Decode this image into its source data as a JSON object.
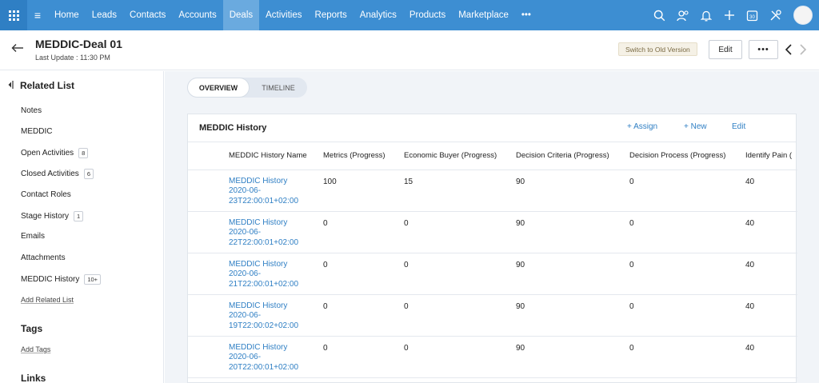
{
  "nav": {
    "items": [
      {
        "label": "Home",
        "active": false
      },
      {
        "label": "Leads",
        "active": false
      },
      {
        "label": "Contacts",
        "active": false
      },
      {
        "label": "Accounts",
        "active": false
      },
      {
        "label": "Deals",
        "active": true
      },
      {
        "label": "Activities",
        "active": false
      },
      {
        "label": "Reports",
        "active": false
      },
      {
        "label": "Analytics",
        "active": false
      },
      {
        "label": "Products",
        "active": false
      },
      {
        "label": "Marketplace",
        "active": false
      }
    ],
    "more": "•••",
    "icons": [
      "search-icon",
      "contacts-icon",
      "bell-icon",
      "plus-icon",
      "calendar-icon",
      "settings-icon"
    ],
    "calendar_day": "30"
  },
  "header": {
    "title": "MEDDIC-Deal 01",
    "last_update": "Last Update : 11:30 PM",
    "switch_label": "Switch to Old Version",
    "edit_label": "Edit",
    "more_label": "•••"
  },
  "sidebar": {
    "heading": "Related List",
    "items": [
      {
        "label": "Notes",
        "badge": ""
      },
      {
        "label": "MEDDIC",
        "badge": ""
      },
      {
        "label": "Open Activities",
        "badge": "8"
      },
      {
        "label": "Closed Activities",
        "badge": "6"
      },
      {
        "label": "Contact Roles",
        "badge": ""
      },
      {
        "label": "Stage History",
        "badge": "1"
      },
      {
        "label": "Emails",
        "badge": ""
      },
      {
        "label": "Attachments",
        "badge": ""
      },
      {
        "label": "MEDDIC History",
        "badge": "10+"
      }
    ],
    "add_related": "Add Related List",
    "tags_heading": "Tags",
    "add_tags": "Add Tags",
    "links_heading": "Links"
  },
  "tabs": {
    "overview": "OVERVIEW",
    "timeline": "TIMELINE"
  },
  "card": {
    "title": "MEDDIC History",
    "assign": "+ Assign",
    "new": "+ New",
    "edit": "Edit",
    "columns": [
      "MEDDIC History Name",
      "Metrics (Progress)",
      "Economic Buyer (Progress)",
      "Decision Criteria (Progress)",
      "Decision Process (Progress)",
      "Identify Pain ("
    ],
    "rows": [
      {
        "name_1": "MEDDIC History",
        "name_2": "2020-06-",
        "name_3": "23T22:00:01+02:00",
        "metrics": "100",
        "buyer": "15",
        "criteria": "90",
        "process": "0",
        "pain": "40"
      },
      {
        "name_1": "MEDDIC History",
        "name_2": "2020-06-",
        "name_3": "22T22:00:01+02:00",
        "metrics": "0",
        "buyer": "0",
        "criteria": "90",
        "process": "0",
        "pain": "40"
      },
      {
        "name_1": "MEDDIC History",
        "name_2": "2020-06-",
        "name_3": "21T22:00:01+02:00",
        "metrics": "0",
        "buyer": "0",
        "criteria": "90",
        "process": "0",
        "pain": "40"
      },
      {
        "name_1": "MEDDIC History",
        "name_2": "2020-06-",
        "name_3": "19T22:00:02+02:00",
        "metrics": "0",
        "buyer": "0",
        "criteria": "90",
        "process": "0",
        "pain": "40"
      },
      {
        "name_1": "MEDDIC History",
        "name_2": "2020-06-",
        "name_3": "20T22:00:01+02:00",
        "metrics": "0",
        "buyer": "0",
        "criteria": "90",
        "process": "0",
        "pain": "40"
      }
    ]
  },
  "colors": {
    "nav_bg": "#3d8ed2",
    "nav_active": "#6aaadf",
    "link": "#2f7fc4",
    "main_bg": "#f1f4f8"
  }
}
